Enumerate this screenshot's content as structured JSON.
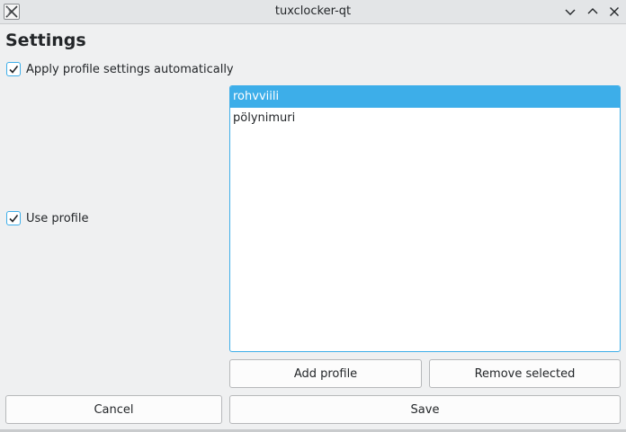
{
  "window": {
    "title": "tuxclocker-qt"
  },
  "settings": {
    "heading": "Settings",
    "apply_automatically": {
      "label": "Apply profile settings automatically",
      "checked": true
    },
    "use_profile": {
      "label": "Use profile",
      "checked": true
    }
  },
  "profiles": {
    "items": [
      {
        "name": "rohvviili",
        "selected": true
      },
      {
        "name": "pölynimuri",
        "selected": false
      }
    ],
    "add_label": "Add profile",
    "remove_label": "Remove selected"
  },
  "footer": {
    "cancel_label": "Cancel",
    "save_label": "Save"
  },
  "colors": {
    "accent": "#3daee9",
    "background": "#eff0f1",
    "text": "#232629"
  },
  "icons": {
    "app": "tuxclocker-app-icon",
    "minimize": "chevron-down-icon",
    "maximize": "chevron-up-icon",
    "close": "close-icon",
    "check": "checkmark-icon"
  }
}
